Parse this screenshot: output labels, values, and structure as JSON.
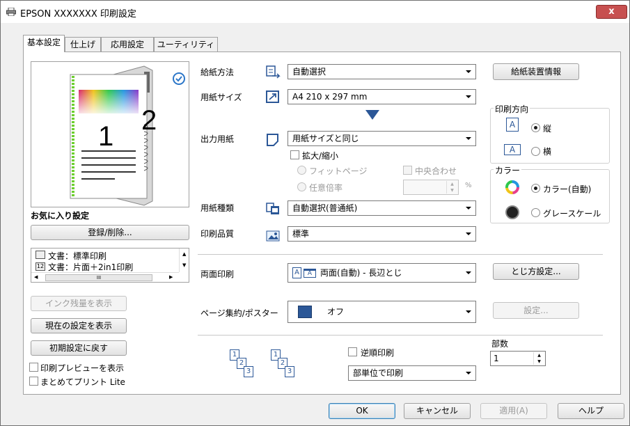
{
  "window": {
    "title": "EPSON XXXXXXX 印刷設定",
    "close_label": "x"
  },
  "tabs": [
    "基本設定",
    "仕上げ",
    "応用設定",
    "ユーティリティー"
  ],
  "preview": {
    "page_front": "1",
    "page_back": "2"
  },
  "favorites": {
    "title": "お気に入り設定",
    "register_button": "登録/削除...",
    "items": [
      {
        "label": "文書：標準印刷"
      },
      {
        "label": "文書：片面＋2in1印刷"
      }
    ],
    "scroll_mid": "III"
  },
  "left_buttons": {
    "ink": "インク残量を表示",
    "current": "現在の設定を表示",
    "reset": "初期設定に戻す"
  },
  "left_checks": {
    "preview": "印刷プレビューを表示",
    "lite": "まとめてプリント Lite"
  },
  "paper_source": {
    "label": "給紙方法",
    "value": "自動選択"
  },
  "feeder_info_button": "給紙装置情報",
  "paper_size": {
    "label": "用紙サイズ",
    "value": "A4 210 x 297 mm"
  },
  "output_paper": {
    "label": "出力用紙",
    "value": "用紙サイズと同じ"
  },
  "scale": {
    "label": "拡大/縮小",
    "fit_page": "フィットページ",
    "any_ratio": "任意倍率",
    "center": "中央合わせ",
    "percent": "%"
  },
  "paper_type": {
    "label": "用紙種類",
    "value": "自動選択(普通紙)"
  },
  "quality": {
    "label": "印刷品質",
    "value": "標準"
  },
  "orientation": {
    "title": "印刷方向",
    "portrait": "縦",
    "landscape": "横",
    "icon_letter": "A"
  },
  "color": {
    "title": "カラー",
    "color_auto": "カラー(自動)",
    "grayscale": "グレースケール"
  },
  "duplex": {
    "label": "両面印刷",
    "value": "両面(自動) - 長辺とじ",
    "binding_button": "とじ方設定...",
    "icon_letter": "A"
  },
  "layout": {
    "label": "ページ集約/ポスター",
    "value": "オフ",
    "settings_button": "設定..."
  },
  "copies": {
    "label": "部数",
    "value": "1",
    "reverse": "逆順印刷",
    "collate_value": "部単位で印刷",
    "stack_labels": [
      "1",
      "2",
      "3"
    ]
  },
  "footer": {
    "ok": "OK",
    "cancel": "キャンセル",
    "apply": "適用(A)",
    "help": "ヘルプ"
  },
  "colors": {
    "accent": "#2b5797",
    "close": "#c75050"
  }
}
